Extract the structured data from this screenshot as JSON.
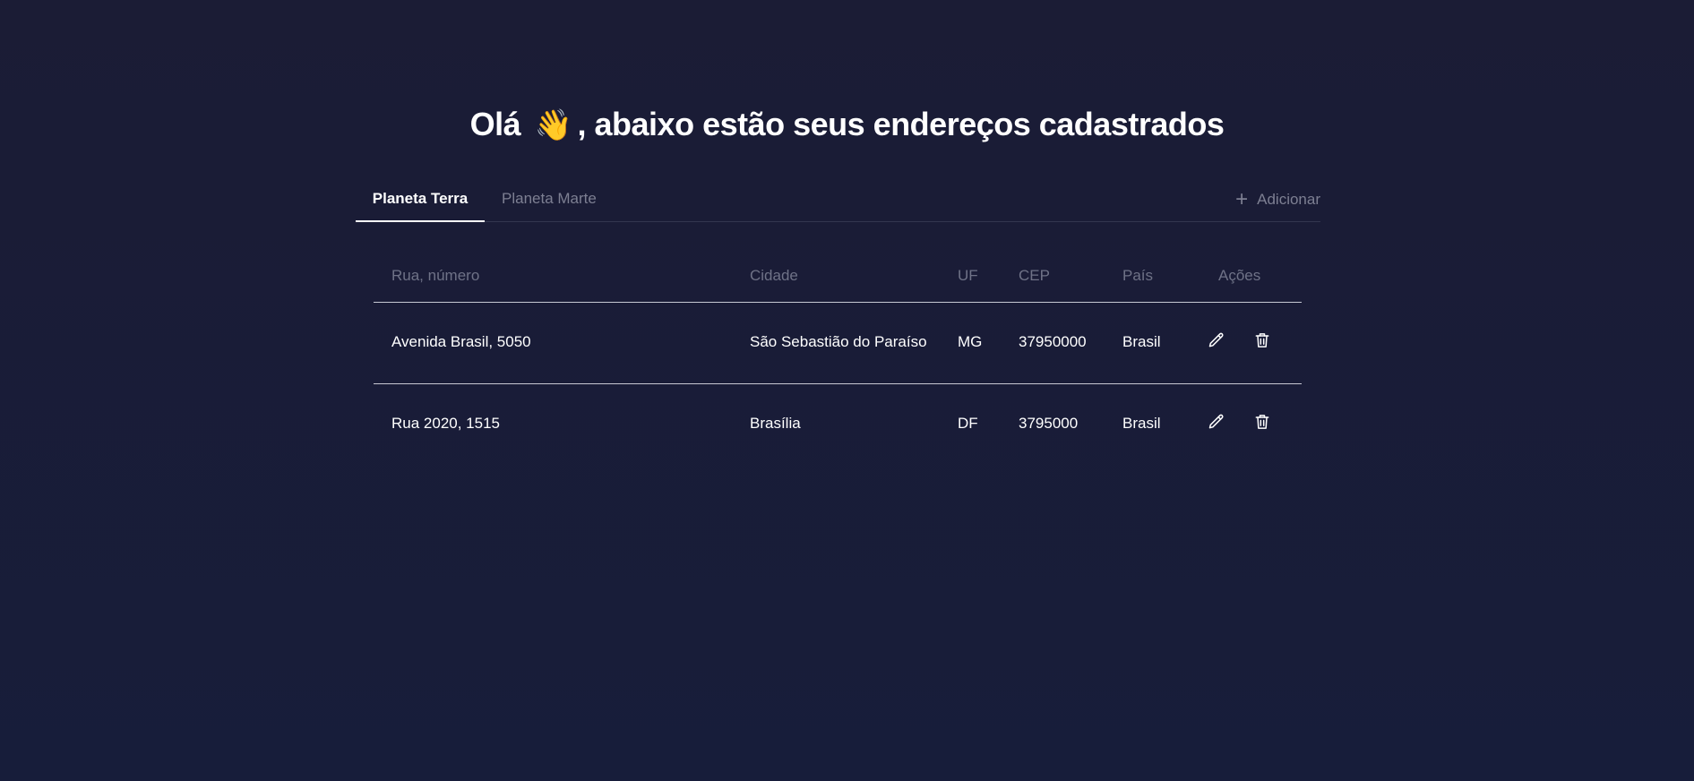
{
  "header": {
    "greeting": "Olá",
    "wave_emoji": "👋",
    "title_rest": ", abaixo estão seus endereços cadastrados"
  },
  "tabs": [
    {
      "label": "Planeta Terra",
      "active": true
    },
    {
      "label": "Planeta Marte",
      "active": false
    }
  ],
  "add_button": {
    "icon": "plus-icon",
    "label": "Adicionar"
  },
  "table": {
    "columns": [
      "Rua, número",
      "Cidade",
      "UF",
      "CEP",
      "País",
      "Ações"
    ],
    "rows": [
      {
        "rua": "Avenida Brasil, 5050",
        "cidade": "São Sebastião do Paraíso",
        "uf": "MG",
        "cep": "37950000",
        "pais": "Brasil"
      },
      {
        "rua": "Rua 2020, 1515",
        "cidade": "Brasília",
        "uf": "DF",
        "cep": "3795000",
        "pais": "Brasil"
      }
    ],
    "row_actions": [
      "pencil-icon",
      "trash-icon"
    ]
  },
  "colors": {
    "background": "#1a1c37",
    "muted_text": "#7d7f92",
    "divider": "#c7c8d3"
  }
}
